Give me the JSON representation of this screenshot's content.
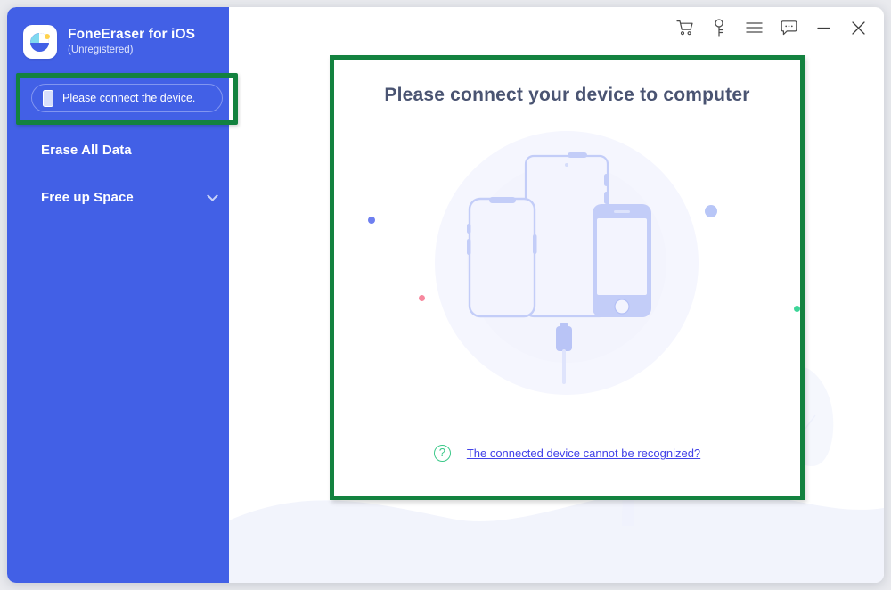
{
  "window": {
    "app_title": "FoneEraser for iOS",
    "registration_status": "(Unregistered)",
    "logo_icon": "foneeraser-logo-icon"
  },
  "titlebar": {
    "tools": [
      {
        "name": "cart-icon",
        "label": "Shop"
      },
      {
        "name": "key-icon",
        "label": "Register"
      },
      {
        "name": "menu-icon",
        "label": "Menu"
      },
      {
        "name": "feedback-icon",
        "label": "Feedback"
      },
      {
        "name": "minimize-icon",
        "label": "Minimize"
      },
      {
        "name": "close-icon",
        "label": "Close"
      }
    ]
  },
  "sidebar": {
    "device_status": {
      "icon": "phone-icon",
      "label": "Please connect the device."
    },
    "items": [
      {
        "label": "Erase All Data",
        "has_chevron": false
      },
      {
        "label": "Free up Space",
        "has_chevron": true
      }
    ]
  },
  "main": {
    "title": "Please connect your device to computer",
    "illustration": {
      "name": "connect-devices-illustration",
      "devices": [
        "iphone-x",
        "ipad",
        "iphone-home-button",
        "lightning-connector"
      ]
    },
    "help": {
      "icon": "question-mark-icon",
      "link_text": "The connected device cannot be recognized?"
    }
  },
  "annotations": {
    "highlight_color": "#13823f",
    "highlight_regions": [
      "sidebar-device-status",
      "main-content-card"
    ]
  },
  "colors": {
    "sidebar_blue": "#4260e6",
    "title_text": "#4a5472",
    "link_blue": "#4242e8",
    "accent_green": "#3dc98a",
    "highlight_green": "#13823f",
    "device_illustration": "#b9c4f6"
  }
}
